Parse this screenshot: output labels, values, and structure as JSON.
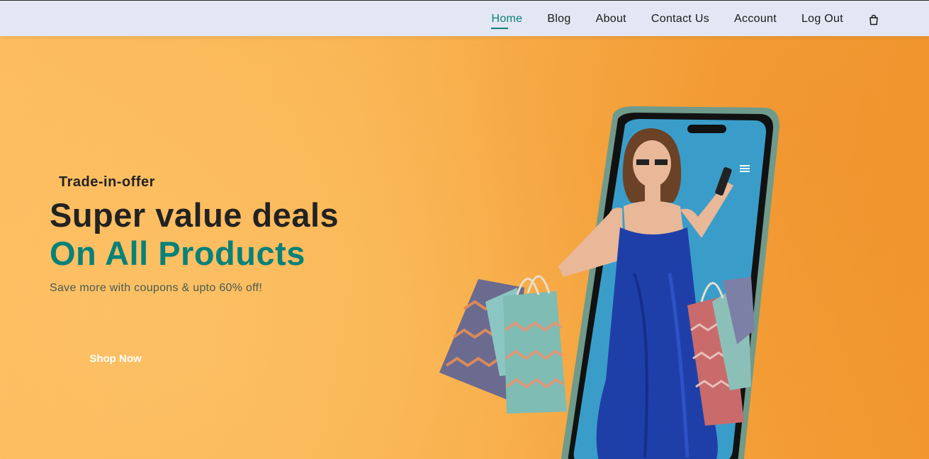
{
  "nav": {
    "items": [
      {
        "label": "Home",
        "active": true
      },
      {
        "label": "Blog",
        "active": false
      },
      {
        "label": "About",
        "active": false
      },
      {
        "label": "Contact Us",
        "active": false
      },
      {
        "label": "Account",
        "active": false
      },
      {
        "label": "Log Out",
        "active": false
      }
    ],
    "cart_icon": "shopping-bag-icon"
  },
  "hero": {
    "eyebrow": "Trade-in-offer",
    "headline": "Super value deals",
    "subheadline": "On All Products",
    "tagline": "Save more with coupons & upto 60% off!",
    "button_label": "Shop Now",
    "image": "woman-with-shopping-bags-stepping-out-of-smartphone"
  },
  "colors": {
    "accent": "#088178",
    "nav_background": "#e3e6f3",
    "hero_background": "#f9b24e",
    "text_dark": "#222222"
  }
}
